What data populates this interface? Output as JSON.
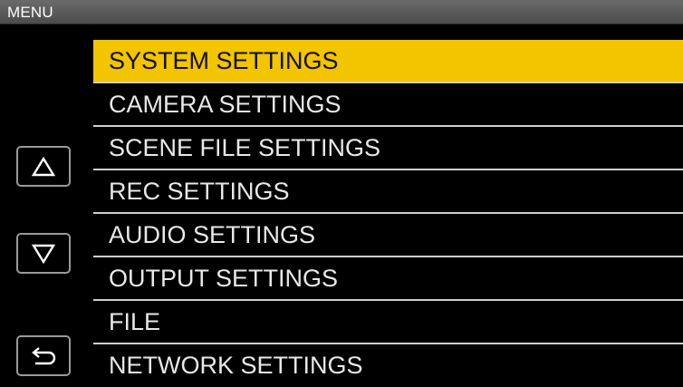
{
  "window": {
    "title": "MENU"
  },
  "sidebar": {
    "buttons": [
      {
        "name": "up-button",
        "icon": "triangle-up-icon"
      },
      {
        "name": "down-button",
        "icon": "triangle-down-icon"
      },
      {
        "name": "back-button",
        "icon": "return-arrow-icon"
      }
    ]
  },
  "menu": {
    "selected_index": 0,
    "items": [
      {
        "label": "SYSTEM SETTINGS"
      },
      {
        "label": "CAMERA SETTINGS"
      },
      {
        "label": "SCENE FILE SETTINGS"
      },
      {
        "label": "REC SETTINGS"
      },
      {
        "label": "AUDIO SETTINGS"
      },
      {
        "label": "OUTPUT SETTINGS"
      },
      {
        "label": "FILE"
      },
      {
        "label": "NETWORK SETTINGS"
      }
    ]
  },
  "colors": {
    "highlight": "#f3c400",
    "background": "#000000",
    "text": "#e8e8e8",
    "divider": "#cfcfcf"
  }
}
